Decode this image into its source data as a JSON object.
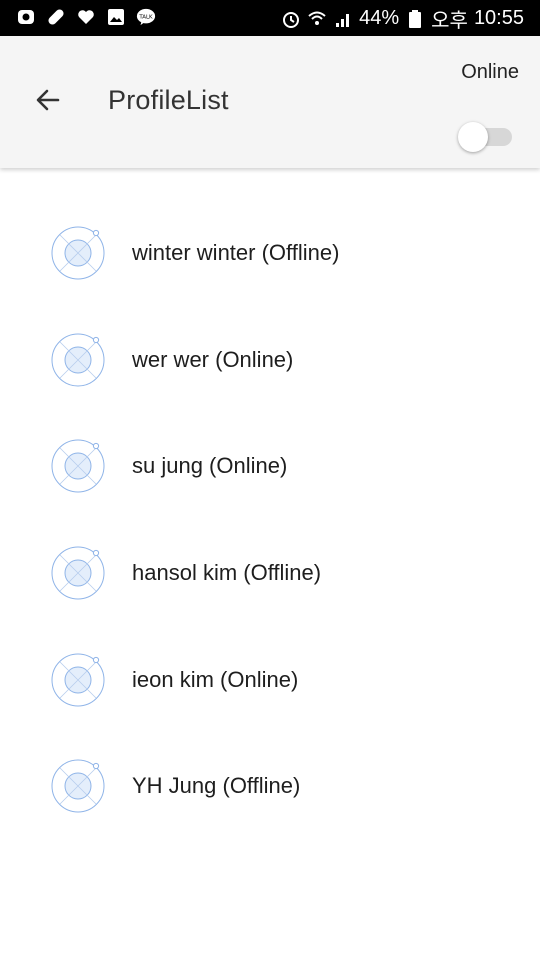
{
  "status_bar": {
    "battery": "44%",
    "ampm": "오후",
    "time": "10:55",
    "left_icons": [
      "usim-icon",
      "pill-icon",
      "heart-icon",
      "gallery-icon",
      "kakaotalk-icon"
    ],
    "right_icons": [
      "alarm-icon",
      "wifi-icon",
      "signal-icon",
      "battery-icon"
    ]
  },
  "app_bar": {
    "title": "ProfileList",
    "back_icon": "arrow-back-icon",
    "toggle_label": "Online",
    "toggle_on": false
  },
  "profiles": [
    {
      "label": "winter winter (Offline)"
    },
    {
      "label": "wer wer (Online)"
    },
    {
      "label": "su jung (Online)"
    },
    {
      "label": "hansol kim (Offline)"
    },
    {
      "label": "ieon kim (Online)"
    },
    {
      "label": "YH Jung (Offline)"
    }
  ],
  "colors": {
    "status_bar_bg": "#000000",
    "app_bar_bg": "#f5f5f5",
    "avatar_stroke": "#8fb4e8",
    "toggle_track": "#d7d7d7"
  }
}
